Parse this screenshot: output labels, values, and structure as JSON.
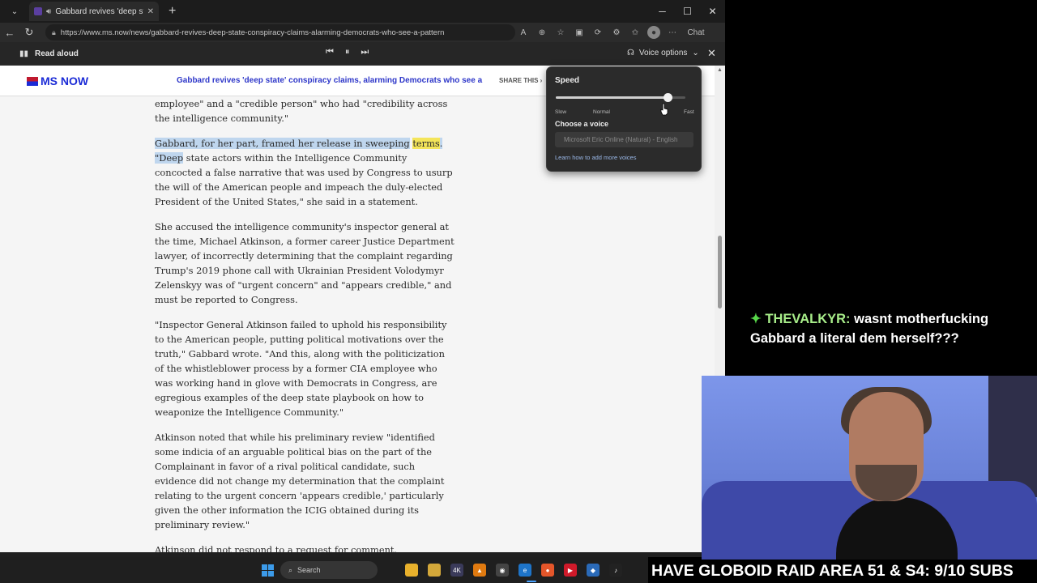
{
  "browser": {
    "tab_title": "Gabbard revives 'deep state' c",
    "url": "https://www.ms.now/news/gabbard-revives-deep-state-conspiracy-claims-alarming-democrats-who-see-a-pattern",
    "chat_label": "Chat"
  },
  "read_aloud": {
    "label": "Read aloud",
    "voice_options_label": "Voice options"
  },
  "site": {
    "logo_text": "MS NOW",
    "header_title": "Gabbard revives 'deep state' conspiracy claims, alarming Democrats who see a patt",
    "share_label": "SHARE THIS"
  },
  "article": {
    "p1": "employee\" and a \"credible person\" who had \"credibility across the intelligence community.\"",
    "p2_highlight": "Gabbard, for her part, framed her release in sweeping",
    "p2_word": "terms",
    "p2_highlight_tail": ". \"Deep",
    "p2_rest": " state actors within the Intelligence Community concocted a false narrative that was used by Congress to usurp the will of the American people and impeach the duly-elected President of the United States,\" she said in a statement.",
    "p3": "She accused the intelligence community's inspector general at the time, Michael Atkinson, a former career Justice Department lawyer, of incorrectly determining that the complaint regarding Trump's 2019 phone call with Ukrainian President Volodymyr Zelenskyy was of \"urgent concern\" and \"appears credible,\" and must be reported to Congress.",
    "p4": "\"Inspector General Atkinson failed to uphold his responsibility to the American people, putting political motivations over the truth,\" Gabbard wrote. \"And this, along with the politicization of the whistleblower process by a former CIA employee who was working hand in glove with Democrats in Congress, are egregious examples of the deep state playbook on how to weaponize the Intelligence Community.\"",
    "p5": "Atkinson noted that while his preliminary review \"identified some indicia of an arguable political bias on the part of the Complainant in favor of a rival political candidate, such evidence did not change my determination that the complaint relating to the urgent concern 'appears credible,' particularly given the other information the ICIG obtained during its preliminary review.\"",
    "p6": "Atkinson did not respond to a request for comment."
  },
  "voice_popup": {
    "speed_label": "Speed",
    "speed_value": 0.86,
    "tick_slow": "Slow",
    "tick_normal": "Normal",
    "tick_fast": "Fast",
    "choose_label": "Choose a voice",
    "voice_selected": "Microsoft Eric Online (Natural) - English",
    "learn_link": "Learn how to add more voices"
  },
  "taskbar": {
    "search_label": "Search"
  },
  "overlay": {
    "chat_user": "THEVALKYR:",
    "chat_text": " wasnt motherfucking Gabbard a literal dem herself???",
    "banner": "HAVE GLOBOID RAID AREA 51 & S4: 9/10 SUBS"
  },
  "colors": {
    "accent_blue": "#2e37c9",
    "highlight_sentence": "#bfd6ee",
    "highlight_word": "#f4e55a",
    "chat_user": "#a8ee8a"
  }
}
